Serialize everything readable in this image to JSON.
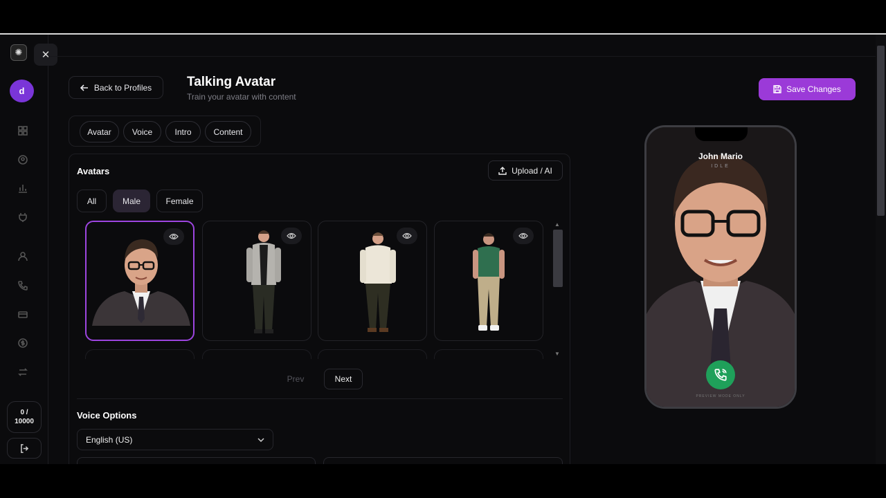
{
  "sidebar": {
    "logo_icon": "brain-logo-icon",
    "close_label": "✕",
    "user_initial": "d",
    "icons": [
      "dashboard-icon",
      "user-circle-icon",
      "bar-chart-icon",
      "plug-icon",
      "person-icon",
      "phone-icon",
      "card-icon",
      "dollar-icon",
      "swap-icon"
    ],
    "credits_used": "0 /",
    "credits_total": "10000"
  },
  "header": {
    "back_label": "Back to Profiles",
    "title": "Talking Avatar",
    "subtitle": "Train your avatar with content",
    "save_label": "Save Changes"
  },
  "tabs": [
    "Avatar",
    "Voice",
    "Intro",
    "Content"
  ],
  "avatars": {
    "title": "Avatars",
    "upload_label": "Upload / AI",
    "filters": [
      "All",
      "Male",
      "Female"
    ],
    "active_filter": "Male",
    "cards": [
      {
        "name": "avatar-suit-glasses",
        "selected": true
      },
      {
        "name": "avatar-grey-cardigan",
        "selected": false
      },
      {
        "name": "avatar-cream-sweater",
        "selected": false
      },
      {
        "name": "avatar-green-polo",
        "selected": false
      }
    ],
    "prev_label": "Prev",
    "next_label": "Next"
  },
  "voice": {
    "title": "Voice Options",
    "language": "English (US)"
  },
  "preview": {
    "name": "John Mario",
    "status": "IDLE",
    "footer": "PREVIEW MODE ONLY"
  },
  "colors": {
    "accent": "#9b3ad8",
    "selected_border": "#9d45e0",
    "call_green": "#1fa05a"
  }
}
